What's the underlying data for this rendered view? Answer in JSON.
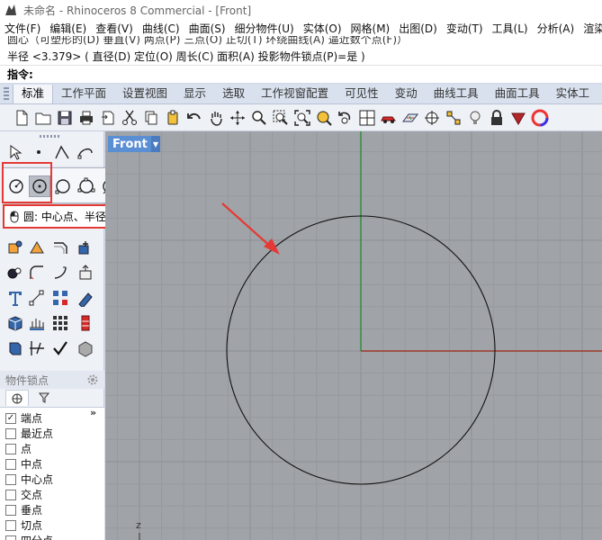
{
  "window": {
    "title": "未命名 - Rhinoceros 8 Commercial - [Front]"
  },
  "menubar": {
    "items": [
      "文件(F)",
      "编辑(E)",
      "查看(V)",
      "曲线(C)",
      "曲面(S)",
      "细分物件(U)",
      "实体(O)",
      "网格(M)",
      "出图(D)",
      "变动(T)",
      "工具(L)",
      "分析(A)",
      "渲染"
    ]
  },
  "command": {
    "history": "圆心（可塑形的(D)  垂直(V)  两点(P)  三点(O)  正切(T)  环绕曲线(A)  逼近数个点(F)）",
    "prompt": "半径 <3.379> ( 直径(D)  定位(O)  周长(C)  面积(A)  投影物件锁点(P)=是 )",
    "input_label": "指令:"
  },
  "tabs": {
    "items": [
      "标准",
      "工作平面",
      "设置视图",
      "显示",
      "选取",
      "工作视窗配置",
      "可见性",
      "变动",
      "曲线工具",
      "曲面工具",
      "实体工"
    ]
  },
  "tooltip": {
    "text": "圆: 中心点、半径"
  },
  "osnap": {
    "header": "物件锁点",
    "more": "»",
    "items": [
      {
        "label": "端点",
        "checked": true,
        "mark": "✓"
      },
      {
        "label": "最近点",
        "checked": false,
        "mark": ""
      },
      {
        "label": "点",
        "checked": false,
        "mark": ""
      },
      {
        "label": "中点",
        "checked": false,
        "mark": ""
      },
      {
        "label": "中心点",
        "checked": false,
        "mark": ""
      },
      {
        "label": "交点",
        "checked": false,
        "mark": ""
      },
      {
        "label": "垂点",
        "checked": false,
        "mark": ""
      },
      {
        "label": "切点",
        "checked": false,
        "mark": ""
      },
      {
        "label": "四分点",
        "checked": false,
        "mark": ""
      }
    ]
  },
  "viewport": {
    "name": "Front",
    "axis_label": "z",
    "colors": {
      "background": "#a0a3a7",
      "grid_minor": "#969a9f",
      "grid_major": "#8b8f94",
      "x_axis": "#9c3a2a",
      "y_axis": "#2f8a3a",
      "circle": "#111111",
      "annotation": "#e53935"
    }
  }
}
